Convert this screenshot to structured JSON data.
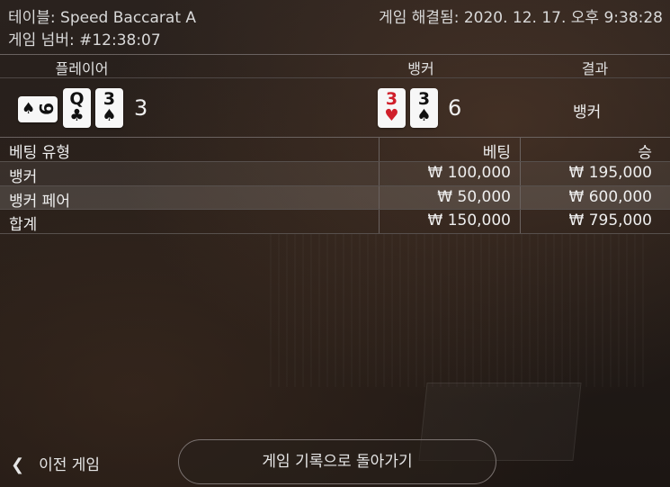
{
  "header": {
    "table_label": "테이블: Speed Baccarat A",
    "game_number_label": "게임 넘버: #12:38:07",
    "resolved_label": "게임 해결됨: 2020. 12. 17. 오후 9:38:28"
  },
  "result": {
    "player_header": "플레이어",
    "banker_header": "뱅커",
    "result_header": "결과",
    "player_cards": [
      {
        "rank": "9",
        "suit": "♠",
        "color": "#111111",
        "orientation": "sideways"
      },
      {
        "rank": "Q",
        "suit": "♣",
        "color": "#111111"
      },
      {
        "rank": "3",
        "suit": "♠",
        "color": "#111111"
      }
    ],
    "player_score": "3",
    "banker_cards": [
      {
        "rank": "3",
        "suit": "♥",
        "color": "#d01f2a"
      },
      {
        "rank": "3",
        "suit": "♠",
        "color": "#111111"
      }
    ],
    "banker_score": "6",
    "winner": "뱅커"
  },
  "bets": {
    "headers": {
      "type": "베팅 유형",
      "bet": "베팅",
      "win": "승"
    },
    "rows": [
      {
        "type": "뱅커",
        "bet": "₩ 100,000",
        "win": "₩ 195,000"
      },
      {
        "type": "뱅커 페어",
        "bet": "₩ 50,000",
        "win": "₩ 600,000"
      }
    ],
    "total": {
      "type": "합계",
      "bet": "₩ 150,000",
      "win": "₩ 795,000"
    }
  },
  "footer": {
    "prev_game_label": "이전 게임",
    "back_to_history_label": "게임 기록으로 돌아가기"
  }
}
